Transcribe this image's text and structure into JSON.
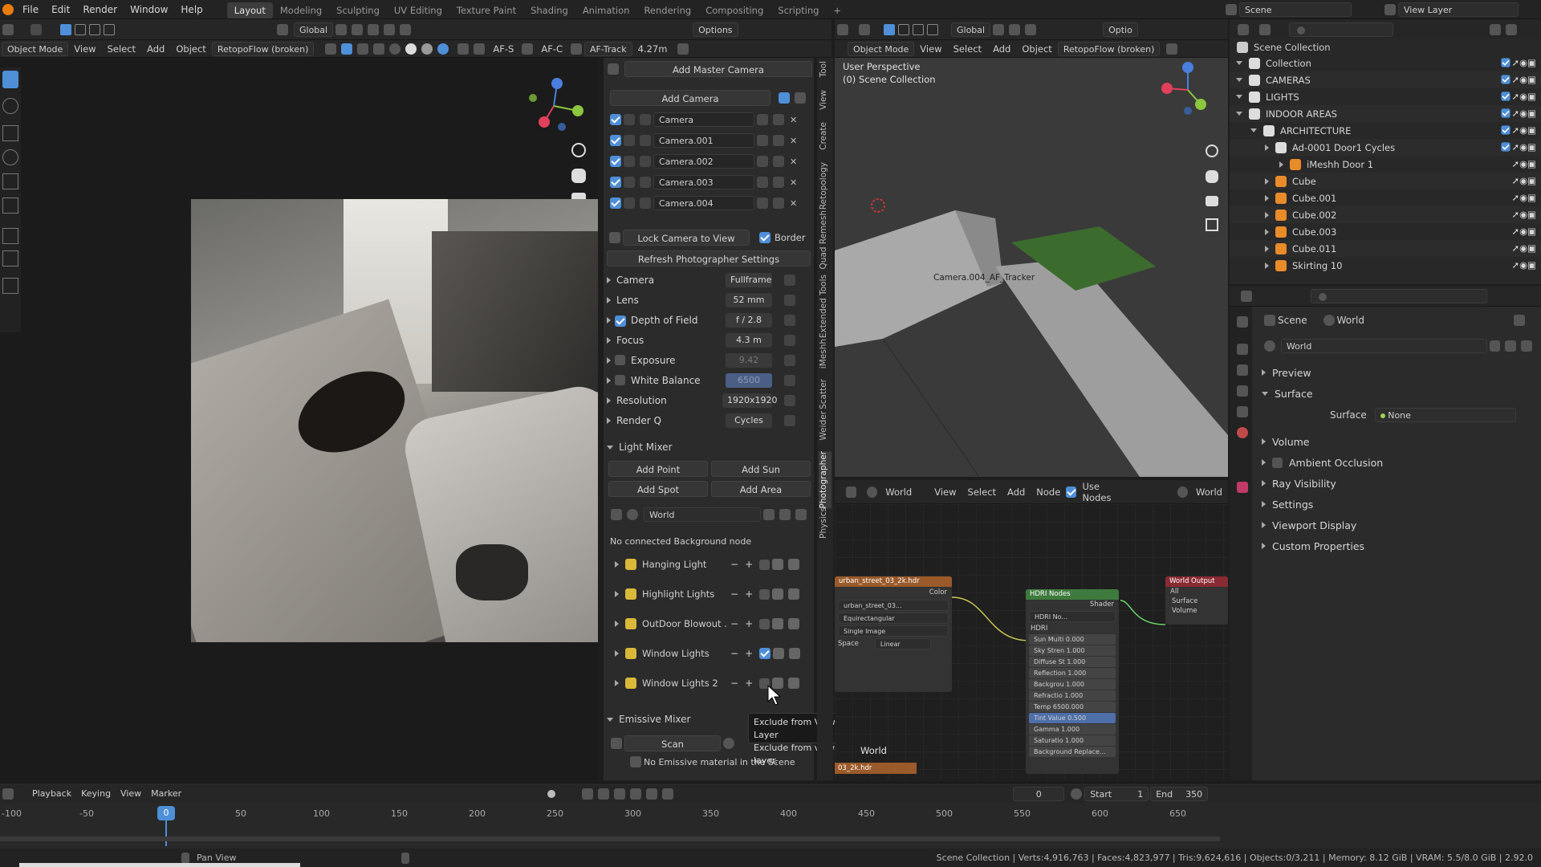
{
  "menu": [
    "File",
    "Edit",
    "Render",
    "Window",
    "Help"
  ],
  "workspaces": [
    "Layout",
    "Modeling",
    "Sculpting",
    "UV Editing",
    "Texture Paint",
    "Shading",
    "Animation",
    "Rendering",
    "Compositing",
    "Scripting"
  ],
  "add_workspace": "+",
  "scene_name": "Scene",
  "view_layer": "View Layer",
  "left_header": {
    "global": "Global",
    "options": "Options",
    "mode": "Object Mode",
    "view": "View",
    "select": "Select",
    "add": "Add",
    "object": "Object",
    "addon": "RetopoFlow (broken)",
    "af_s": "AF-S",
    "af_c": "AF-C",
    "af_track": "AF-Track",
    "distance": "4.27m"
  },
  "photographer": {
    "add_master_camera": "Add Master Camera",
    "add_camera": "Add Camera",
    "cameras": [
      "Camera",
      "Camera.001",
      "Camera.002",
      "Camera.003",
      "Camera.004"
    ],
    "lock_camera": "Lock Camera to View",
    "border": "Border",
    "refresh": "Refresh Photographer Settings",
    "settings": [
      {
        "label": "Camera",
        "value": "Fullframe"
      },
      {
        "label": "Lens",
        "value": "52 mm"
      },
      {
        "label": "Depth of Field",
        "value": "f / 2.8"
      },
      {
        "label": "Focus",
        "value": "4.3 m"
      },
      {
        "label": "Exposure",
        "value": "9.42"
      },
      {
        "label": "White Balance",
        "value": "6500"
      },
      {
        "label": "Resolution",
        "value": "1920x1920"
      },
      {
        "label": "Render Q",
        "value": "Cycles"
      }
    ],
    "light_mixer": "Light Mixer",
    "add_point": "Add Point",
    "add_sun": "Add Sun",
    "add_spot": "Add Spot",
    "add_area": "Add Area",
    "world": "World",
    "no_bg": "No connected Background node",
    "light_groups": [
      "Hanging Light",
      "Highlight Lights",
      "OutDoor Blowout ...",
      "Window Lights",
      "Window Lights 2"
    ],
    "emissive_mixer": "Emissive Mixer",
    "scan": "Scan",
    "no_emissive": "No Emissive material in the Scene"
  },
  "tooltip": {
    "line1": "Exclude from View Layer",
    "line2": "Exclude from view layer."
  },
  "vertical_tabs": [
    "Tool",
    "View",
    "Create",
    "Retopology",
    "Quad Remesh",
    "Extended Tools",
    "iMeshh",
    "Scatter",
    "Weider",
    "Photographer",
    "Physics"
  ],
  "right_view": {
    "mode": "Object Mode",
    "view": "View",
    "select": "Select",
    "add": "Add",
    "object": "Object",
    "addon": "RetopoFlow (broken)",
    "global": "Global",
    "options": "Optio",
    "persp": "User Perspective",
    "collection": "(0) Scene Collection",
    "camera_label": "Camera.004_AF_Tracker"
  },
  "node_editor": {
    "world": "World",
    "view": "View",
    "select": "Select",
    "add": "Add",
    "node": "Node",
    "use_nodes": "Use Nodes",
    "world_right": "World",
    "img_node": "urban_street_03_2k.hdr",
    "img_file": "urban_street_03...",
    "color": "Color",
    "proj": "Equirectangular",
    "ext": "Single Image",
    "space": "Space",
    "linear": "Linear",
    "hdri_nodes": "HDRI Nodes",
    "shader": "Shader",
    "hdri_no": "HDRI No...",
    "hdri": "HDRI",
    "params": [
      "Sun Multi 0.000",
      "Sky Stren 1.000",
      "Diffuse St 1.000",
      "Reflection 1.000",
      "Backgrou 1.000",
      "Refractio 1.000",
      "Temp 6500.000",
      "Tint Value 0.500",
      "Gamma 1.000",
      "Saturatio 1.000",
      "Background Replace..."
    ],
    "world_output": "World Output",
    "all": "All",
    "surface": "Surface",
    "volume": "Volume",
    "world_label": "World",
    "hdr2": "03_2k.hdr"
  },
  "outliner": {
    "title": "Scene Collection",
    "rows": [
      {
        "name": "Collection",
        "indent": 0
      },
      {
        "name": "CAMERAS",
        "indent": 0
      },
      {
        "name": "LIGHTS",
        "indent": 0
      },
      {
        "name": "INDOOR AREAS",
        "indent": 0
      },
      {
        "name": "ARCHITECTURE",
        "indent": 1
      },
      {
        "name": "Ad-0001 Door1 Cycles",
        "indent": 2
      },
      {
        "name": "iMeshh Door 1",
        "indent": 3
      },
      {
        "name": "Cube",
        "indent": 2
      },
      {
        "name": "Cube.001",
        "indent": 2
      },
      {
        "name": "Cube.002",
        "indent": 2
      },
      {
        "name": "Cube.003",
        "indent": 2
      },
      {
        "name": "Cube.011",
        "indent": 2
      },
      {
        "name": "Skirting 10",
        "indent": 2
      }
    ]
  },
  "properties": {
    "scene": "Scene",
    "world": "World",
    "world_field": "World",
    "sections": [
      "Preview",
      "Surface"
    ],
    "surface_label": "Surface",
    "surface_value": "None",
    "sections2": [
      "Volume",
      "Ambient Occlusion",
      "Ray Visibility",
      "Settings",
      "Viewport Display",
      "Custom Properties"
    ]
  },
  "timeline": {
    "playback": "Playback",
    "keying": "Keying",
    "view": "View",
    "marker": "Marker",
    "current_frame": "0",
    "start_label": "Start",
    "start": "1",
    "end_label": "End",
    "end": "350",
    "marker_frame": "0",
    "ticks": [
      "-100",
      "-50",
      "0",
      "50",
      "100",
      "150",
      "200",
      "250",
      "300",
      "350",
      "400",
      "450",
      "500",
      "550",
      "600",
      "650"
    ]
  },
  "status": {
    "pan": "Pan View",
    "stats": "Scene Collection | Verts:4,916,763 | Faces:4,823,977 | Tris:9,624,616 | Objects:0/3,211 | Memory: 8.12 GiB | VRAM: 5.5/8.0 GiB | 2.92.0"
  }
}
